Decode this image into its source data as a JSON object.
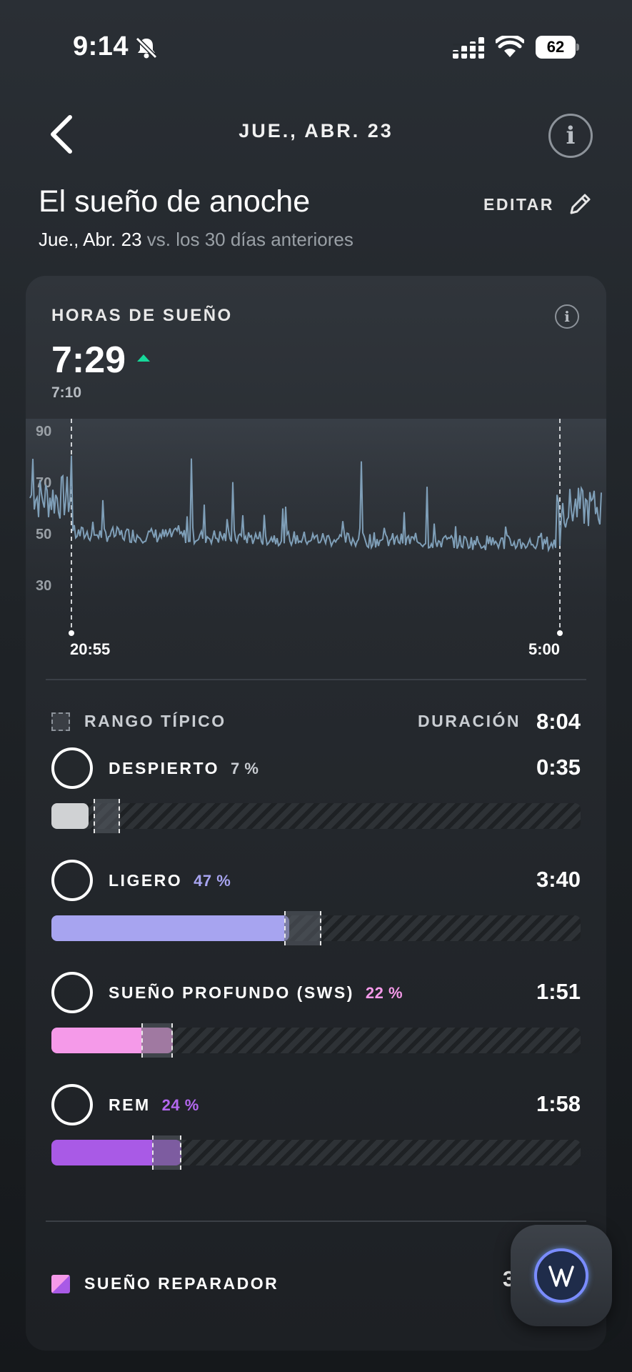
{
  "status_bar": {
    "time": "9:14",
    "battery": "62"
  },
  "header": {
    "date": "JUE., ABR. 23"
  },
  "page": {
    "title": "El sueño de anoche",
    "edit_label": "EDITAR",
    "subtitle_date": "Jue., Abr. 23",
    "subtitle_rest": " vs. los 30 días anteriores"
  },
  "card": {
    "label": "HORAS DE SUEÑO",
    "value": "7:29",
    "baseline": "7:10",
    "trend": "up",
    "chart": {
      "y_ticks": [
        "90",
        "70",
        "50",
        "30"
      ],
      "start_label": "20:55",
      "end_label": "5:00"
    },
    "legend": {
      "range_label": "RANGO TÍPICO",
      "duration_label": "DURACIÓN",
      "duration_value": "8:04"
    },
    "stages": [
      {
        "name": "DESPIERTO",
        "pct": "7 %",
        "time": "0:35",
        "color": "#d0d2d4",
        "pct_color": "#c9cdd2",
        "fill": 0.07,
        "range": [
          0.08,
          0.13
        ]
      },
      {
        "name": "LIGERO",
        "pct": "47 %",
        "time": "3:40",
        "color": "#a7a4f0",
        "pct_color": "#a7a4f0",
        "fill": 0.45,
        "range": [
          0.44,
          0.51
        ]
      },
      {
        "name": "SUEÑO PROFUNDO (SWS)",
        "pct": "22 %",
        "time": "1:51",
        "color": "#f59ae9",
        "pct_color": "#f59ae9",
        "fill": 0.23,
        "range": [
          0.17,
          0.23
        ]
      },
      {
        "name": "REM",
        "pct": "24 %",
        "time": "1:58",
        "color": "#a95ae6",
        "pct_color": "#b468f0",
        "fill": 0.245,
        "range": [
          0.19,
          0.245
        ]
      }
    ],
    "restorative_label": "SUEÑO REPARADOR",
    "restorative_value_peek": "3"
  },
  "colors": {
    "accent_up": "#16d99a",
    "hr_line": "#7f9fb8"
  }
}
